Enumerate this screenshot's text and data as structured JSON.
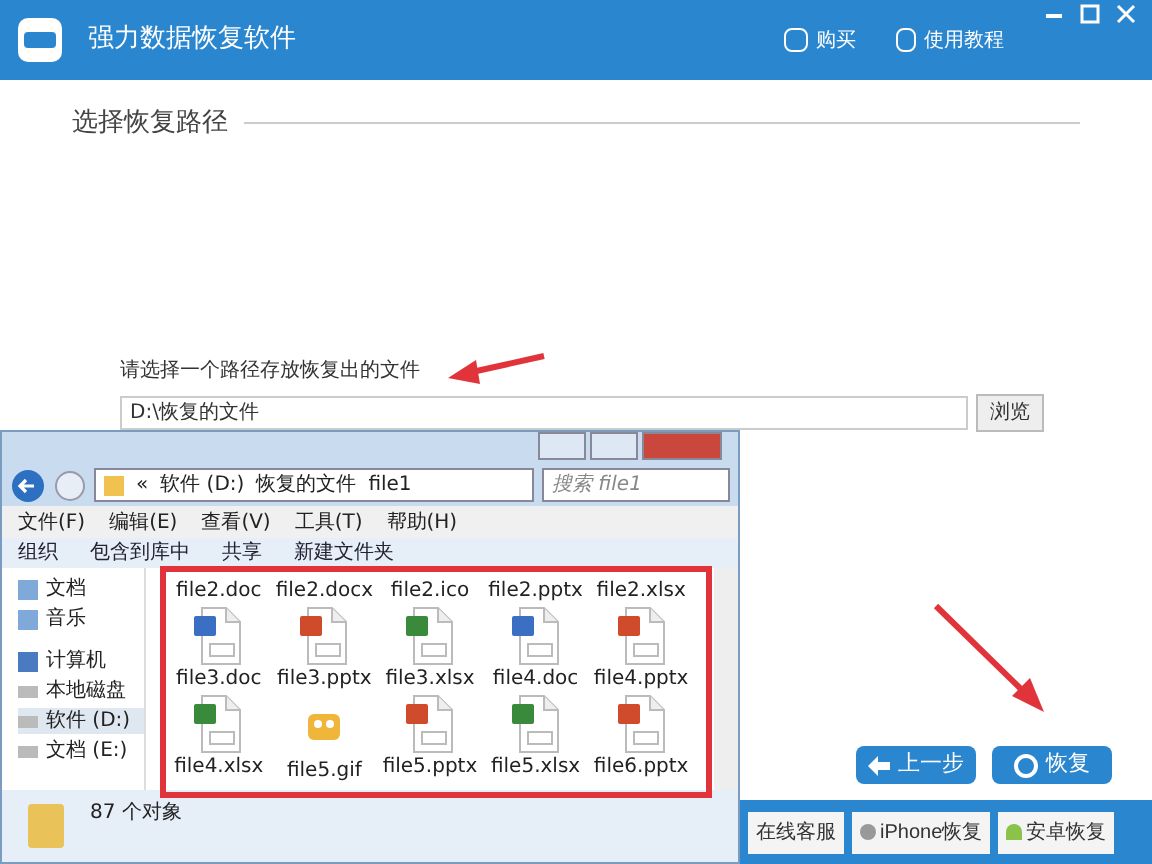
{
  "window": {
    "title": "强力数据恢复软件"
  },
  "header_links": [
    {
      "label": "购买",
      "kind": "buy"
    },
    {
      "label": "使用教程",
      "kind": "guide"
    }
  ],
  "section_title": "选择恢复路径",
  "path": {
    "label": "请选择一个路径存放恢复出的文件",
    "value": "D:\\恢复的文件",
    "browse": "浏览"
  },
  "explorer": {
    "breadcrumb": [
      "«",
      "软件 (D:)",
      "恢复的文件",
      "file1"
    ],
    "search_placeholder": "搜索 file1",
    "menu": [
      "文件(F)",
      "编辑(E)",
      "查看(V)",
      "工具(T)",
      "帮助(H)"
    ],
    "toolbar": [
      "组织",
      "包含到库中",
      "共享",
      "新建文件夹"
    ],
    "nav": [
      {
        "label": "文档",
        "kind": "library",
        "selected": false
      },
      {
        "label": "音乐",
        "kind": "library",
        "selected": false
      },
      {
        "label": "计算机",
        "kind": "computer",
        "selected": false
      },
      {
        "label": "本地磁盘",
        "kind": "drive",
        "selected": false
      },
      {
        "label": "软件 (D:)",
        "kind": "drive",
        "selected": true
      },
      {
        "label": "文档 (E:)",
        "kind": "drive",
        "selected": false
      }
    ],
    "files": [
      {
        "name": "file2.doc",
        "kind": "hidden"
      },
      {
        "name": "file2.docx",
        "kind": "hidden"
      },
      {
        "name": "file2.ico",
        "kind": "hidden"
      },
      {
        "name": "file2.pptx",
        "kind": "hidden"
      },
      {
        "name": "file2.xlsx",
        "kind": "hidden"
      },
      {
        "name": "file3.doc",
        "kind": "doc"
      },
      {
        "name": "file3.pptx",
        "kind": "ppt"
      },
      {
        "name": "file3.xlsx",
        "kind": "xls"
      },
      {
        "name": "file4.doc",
        "kind": "doc"
      },
      {
        "name": "file4.pptx",
        "kind": "ppt"
      },
      {
        "name": "file4.xlsx",
        "kind": "xls"
      },
      {
        "name": "file5.gif",
        "kind": "gif"
      },
      {
        "name": "file5.pptx",
        "kind": "ppt"
      },
      {
        "name": "file5.xlsx",
        "kind": "xls"
      },
      {
        "name": "file6.pptx",
        "kind": "ppt"
      }
    ],
    "status": "87 个对象"
  },
  "buttons": [
    {
      "label": "上一步",
      "kind": "back"
    },
    {
      "label": "恢复",
      "kind": "recover"
    }
  ],
  "bottom_bar": [
    {
      "label": "在线客服",
      "kind": "service"
    },
    {
      "label": "iPhone恢复",
      "kind": "iphone"
    },
    {
      "label": "安卓恢复",
      "kind": "android"
    }
  ]
}
